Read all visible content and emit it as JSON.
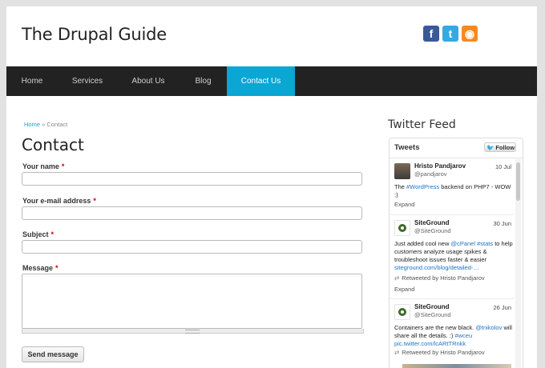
{
  "site": {
    "title": "The Drupal Guide"
  },
  "social": [
    {
      "name": "facebook-icon",
      "glyph": "f",
      "color": "#3b5998"
    },
    {
      "name": "twitter-icon",
      "glyph": "t",
      "color": "#35a9e0"
    },
    {
      "name": "rss-icon",
      "glyph": "◉",
      "color": "#f58a1f"
    }
  ],
  "nav": {
    "items": [
      "Home",
      "Services",
      "About Us",
      "Blog",
      "Contact Us"
    ],
    "active_index": 4,
    "accent": "#0aa6d4"
  },
  "breadcrumb": {
    "home": "Home",
    "separator": " » ",
    "current": "Contact"
  },
  "form": {
    "title": "Contact",
    "name_label": "Your name",
    "email_label": "Your e-mail address",
    "subject_label": "Subject",
    "message_label": "Message",
    "required_mark": "*",
    "submit_label": "Send message"
  },
  "twitter": {
    "heading": "Twitter Feed",
    "widget_title": "Tweets",
    "follow_label": "Follow",
    "tweets": [
      {
        "author": "Hristo Pandjarov",
        "handle": "@pandjarov",
        "date": "10 Jul",
        "text_html": "The <a>#WordPress</a> backend on PHP7 - WOW :)",
        "expand": "Expand"
      },
      {
        "author": "SiteGround",
        "handle": "@SiteGround",
        "date": "30 Jun",
        "text_html": "Just added cool new <a>@cPanel</a> <a>#stats</a> to help customers analyze usage spikes &amp; troubleshoot issues faster &amp; easier <a>siteground.com/blog/detailed-…</a>",
        "retweet": "Retweeted by Hristo Pandjarov",
        "expand": "Expand"
      },
      {
        "author": "SiteGround",
        "handle": "@SiteGround",
        "date": "26 Jun",
        "text_html": "Containers are the new black. <a>@tnikolov</a> will share all the details. :) <a>#wceu</a> <a>pic.twitter.com/lcARtTRnkk</a>",
        "retweet": "Retweeted by Hristo Pandjarov"
      }
    ]
  }
}
